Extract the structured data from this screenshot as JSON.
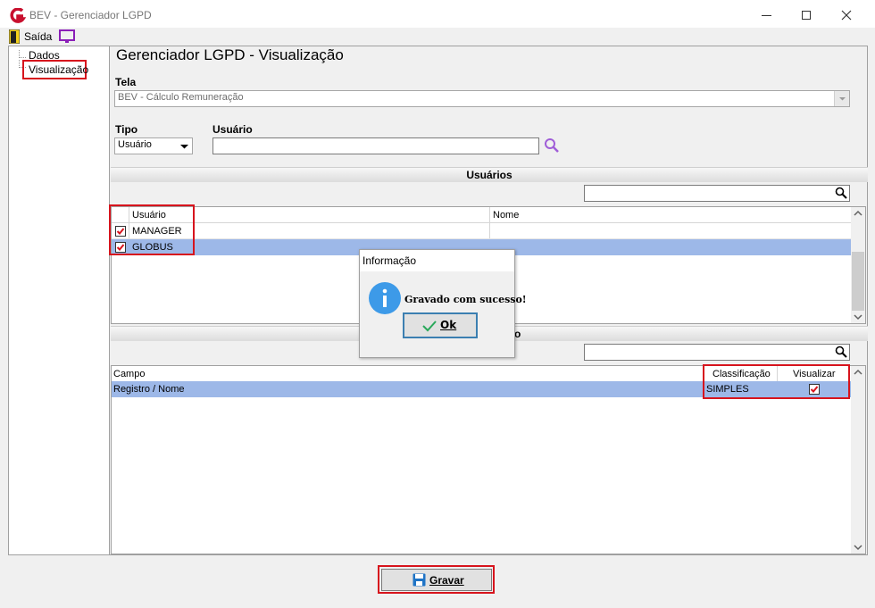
{
  "window": {
    "title": "BEV - Gerenciador LGPD"
  },
  "toolbar": {
    "exit_label": "Saída"
  },
  "tree": {
    "items": [
      {
        "label": "Dados"
      },
      {
        "label": "Visualização"
      }
    ]
  },
  "main": {
    "title": "Gerenciador LGPD - Visualização",
    "tela": {
      "label": "Tela",
      "value": "BEV - Cálculo Remuneração"
    },
    "tipo": {
      "label": "Tipo",
      "value": "Usuário"
    },
    "usuario": {
      "label": "Usuário",
      "value": ""
    }
  },
  "users_section": {
    "title": "Usuários",
    "columns": [
      "Usuário",
      "Nome"
    ],
    "rows": [
      {
        "checked": true,
        "usuario": "MANAGER",
        "nome": ""
      },
      {
        "checked": true,
        "usuario": "GLOBUS",
        "nome": ""
      }
    ]
  },
  "fields_section": {
    "title_visible": "o",
    "columns": [
      "Campo",
      "Classificação",
      "Visualizar"
    ],
    "rows": [
      {
        "campo": "Registro / Nome",
        "classificacao": "SIMPLES",
        "visualizar": true
      }
    ]
  },
  "dialog": {
    "title": "Informação",
    "message": "Gravado com sucesso!",
    "ok_label": "Ok"
  },
  "footer": {
    "save_label": "Gravar"
  },
  "colors": {
    "accent": "#d7141d",
    "selection": "#9db8e8",
    "brand": "#c8102e"
  }
}
